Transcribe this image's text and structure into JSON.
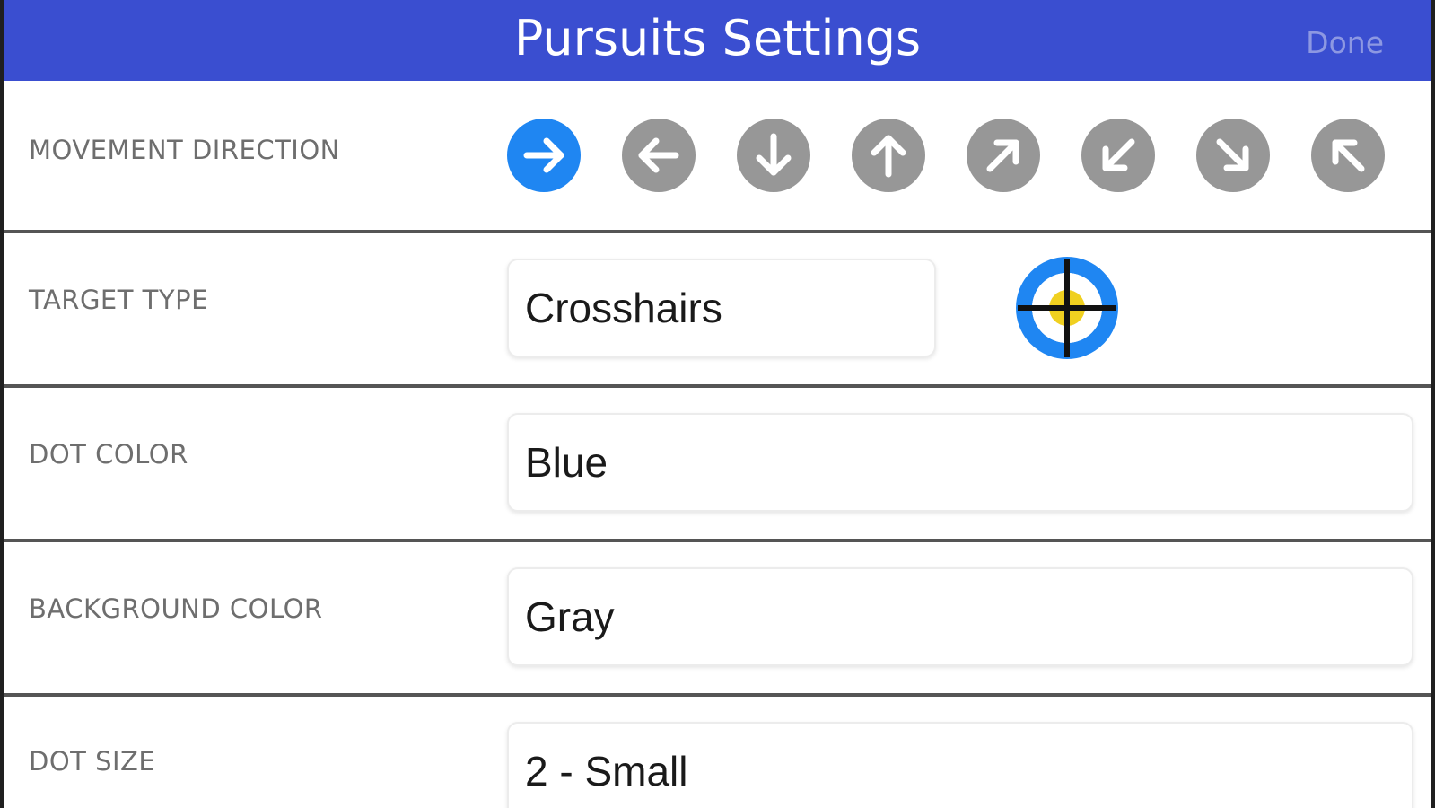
{
  "header": {
    "title": "Pursuits Settings",
    "done_label": "Done",
    "bg_color": "#3a4ed0"
  },
  "movement_direction": {
    "label": "MOVEMENT DIRECTION",
    "selected": "right",
    "active_color": "#1f86f2",
    "inactive_color": "#979797",
    "options": [
      "right-arrow-icon",
      "left-arrow-icon",
      "down-arrow-icon",
      "up-arrow-icon",
      "up-right-arrow-icon",
      "down-left-arrow-icon",
      "down-right-arrow-icon",
      "up-left-arrow-icon"
    ]
  },
  "target_type": {
    "label": "TARGET TYPE",
    "value": "Crosshairs",
    "preview_icon": "crosshairs-target-icon"
  },
  "dot_color": {
    "label": "DOT COLOR",
    "value": "Blue"
  },
  "background_color": {
    "label": "BACKGROUND COLOR",
    "value": "Gray"
  },
  "dot_size": {
    "label": "DOT SIZE",
    "value": "2 - Small"
  }
}
